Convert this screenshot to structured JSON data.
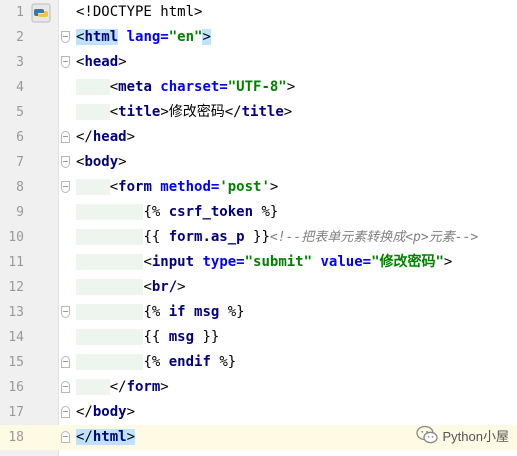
{
  "editor": {
    "lines": [
      {
        "num": "1"
      },
      {
        "num": "2"
      },
      {
        "num": "3"
      },
      {
        "num": "4"
      },
      {
        "num": "5"
      },
      {
        "num": "6"
      },
      {
        "num": "7"
      },
      {
        "num": "8"
      },
      {
        "num": "9"
      },
      {
        "num": "10"
      },
      {
        "num": "11"
      },
      {
        "num": "12"
      },
      {
        "num": "13"
      },
      {
        "num": "14"
      },
      {
        "num": "15"
      },
      {
        "num": "16"
      },
      {
        "num": "17"
      },
      {
        "num": "18"
      }
    ],
    "code": {
      "l1": {
        "doctype": "<!DOCTYPE html>"
      },
      "l2": {
        "open": "<",
        "tag": "html",
        "attr": " lang=",
        "val": "\"en\"",
        "close": ">"
      },
      "l3": {
        "open": "<",
        "tag": "head",
        "close": ">"
      },
      "l4": {
        "open": "<",
        "tag": "meta",
        "attr": " charset=",
        "val": "\"UTF-8\"",
        "close": ">"
      },
      "l5": {
        "open": "<",
        "tag": "title",
        "close": ">",
        "text": "修改密码",
        "end_open": "</",
        "end_tag": "title",
        "end_close": ">"
      },
      "l6": {
        "open": "</",
        "tag": "head",
        "close": ">"
      },
      "l7": {
        "open": "<",
        "tag": "body",
        "close": ">"
      },
      "l8": {
        "open": "<",
        "tag": "form",
        "attr": " method=",
        "val": "'post'",
        "close": ">"
      },
      "l9": {
        "a": "{% ",
        "kw": "csrf_token",
        "b": " %}"
      },
      "l10": {
        "a": "{{ ",
        "kw": "form.as_p",
        "b": " }}",
        "comment_a": "<!--把表单元素转换成",
        "comment_tag": "<p>",
        "comment_b": "元素-->"
      },
      "l11": {
        "open": "<",
        "tag": "input",
        "attr1": " type=",
        "val1": "\"submit\"",
        "attr2": " value=",
        "val2": "\"修改密码\"",
        "close": ">"
      },
      "l12": {
        "open": "<",
        "tag": "br/",
        "close": ">"
      },
      "l13": {
        "a": "{% ",
        "kw1": "if",
        "mid": " ",
        "kw2": "msg",
        "b": " %}"
      },
      "l14": {
        "a": "{{ ",
        "kw": "msg",
        "b": " }}"
      },
      "l15": {
        "a": "{% ",
        "kw": "endif",
        "b": " %}"
      },
      "l16": {
        "open": "</",
        "tag": "form",
        "close": ">"
      },
      "l17": {
        "open": "</",
        "tag": "body",
        "close": ">"
      },
      "l18": {
        "open": "</",
        "tag": "html",
        "close": ">"
      }
    }
  },
  "watermark": {
    "text": "Python小屋"
  },
  "colors": {
    "tag": "#000080",
    "attr": "#0000ff",
    "string": "#008000",
    "comment": "#808080",
    "current_line": "#fffae3",
    "tag_highlight": "#bfe3ff"
  },
  "icons": {
    "file_type": "python-icon",
    "watermark": "wechat-icon"
  }
}
